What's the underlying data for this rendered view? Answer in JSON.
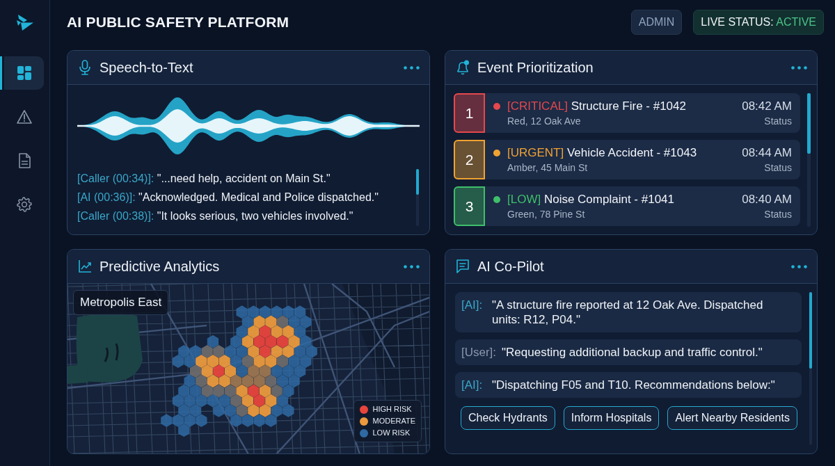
{
  "sidebar": {
    "items": [
      {
        "selected": true
      },
      {
        "selected": false
      },
      {
        "selected": false
      },
      {
        "selected": false
      }
    ]
  },
  "header": {
    "title": "AI PUBLIC SAFETY PLATFORM",
    "role_badge": "ADMIN",
    "status_badge": {
      "label": "LIVE STATUS:",
      "value": "ACTIVE"
    }
  },
  "speech_to_text": {
    "title": "Speech-to-Text",
    "transcript": [
      {
        "speaker": "[Caller (00:34)]:",
        "text": "\"...need help, accident on Main St.\""
      },
      {
        "speaker": "[AI (00:36)]:",
        "text": "\"Acknowledged. Medical and Police dispatched.\""
      },
      {
        "speaker": "[Caller (00:38)]:",
        "text": "\"It looks serious, two vehicles involved.\""
      }
    ]
  },
  "event_prioritization": {
    "title": "Event Prioritization",
    "events": [
      {
        "rank": "1",
        "tag": "[CRITICAL]",
        "title": "Structure Fire - #1042",
        "location": "Red, 12 Oak Ave",
        "time": "08:42 AM",
        "status": "Status",
        "color": "#e5484d"
      },
      {
        "rank": "2",
        "tag": "[URGENT]",
        "title": "Vehicle Accident - #1043",
        "location": "Amber, 45 Main St",
        "time": "08:44 AM",
        "status": "Status",
        "color": "#f0a232"
      },
      {
        "rank": "3",
        "tag": "[LOW]",
        "title": "Noise Complaint - #1041",
        "location": "Green, 78 Pine St",
        "time": "08:40 AM",
        "status": "Status",
        "color": "#3fbf6a"
      }
    ]
  },
  "predictive_analytics": {
    "title": "Predictive Analytics",
    "area_label": "Metropolis East",
    "legend": [
      {
        "label": "HIGH RISK",
        "color": "#e8453c"
      },
      {
        "label": "MODERATE",
        "color": "#eb9a3d"
      },
      {
        "label": "LOW RISK",
        "color": "#2f6aa3"
      }
    ]
  },
  "ai_copilot": {
    "title": "AI Co-Pilot",
    "messages": [
      {
        "kind": "ai",
        "speaker": "[AI]:",
        "text": "\"A structure fire reported at 12 Oak Ave. Dispatched units: R12, P04.\""
      },
      {
        "kind": "user",
        "speaker": "[User]:",
        "text": "\"Requesting additional backup and traffic control.\""
      },
      {
        "kind": "ai",
        "speaker": "[AI]:",
        "text": "\"Dispatching F05 and T10. Recommendations below:\""
      }
    ],
    "actions": [
      "Check Hydrants",
      "Inform Hospitals",
      "Alert Nearby Residents"
    ]
  }
}
